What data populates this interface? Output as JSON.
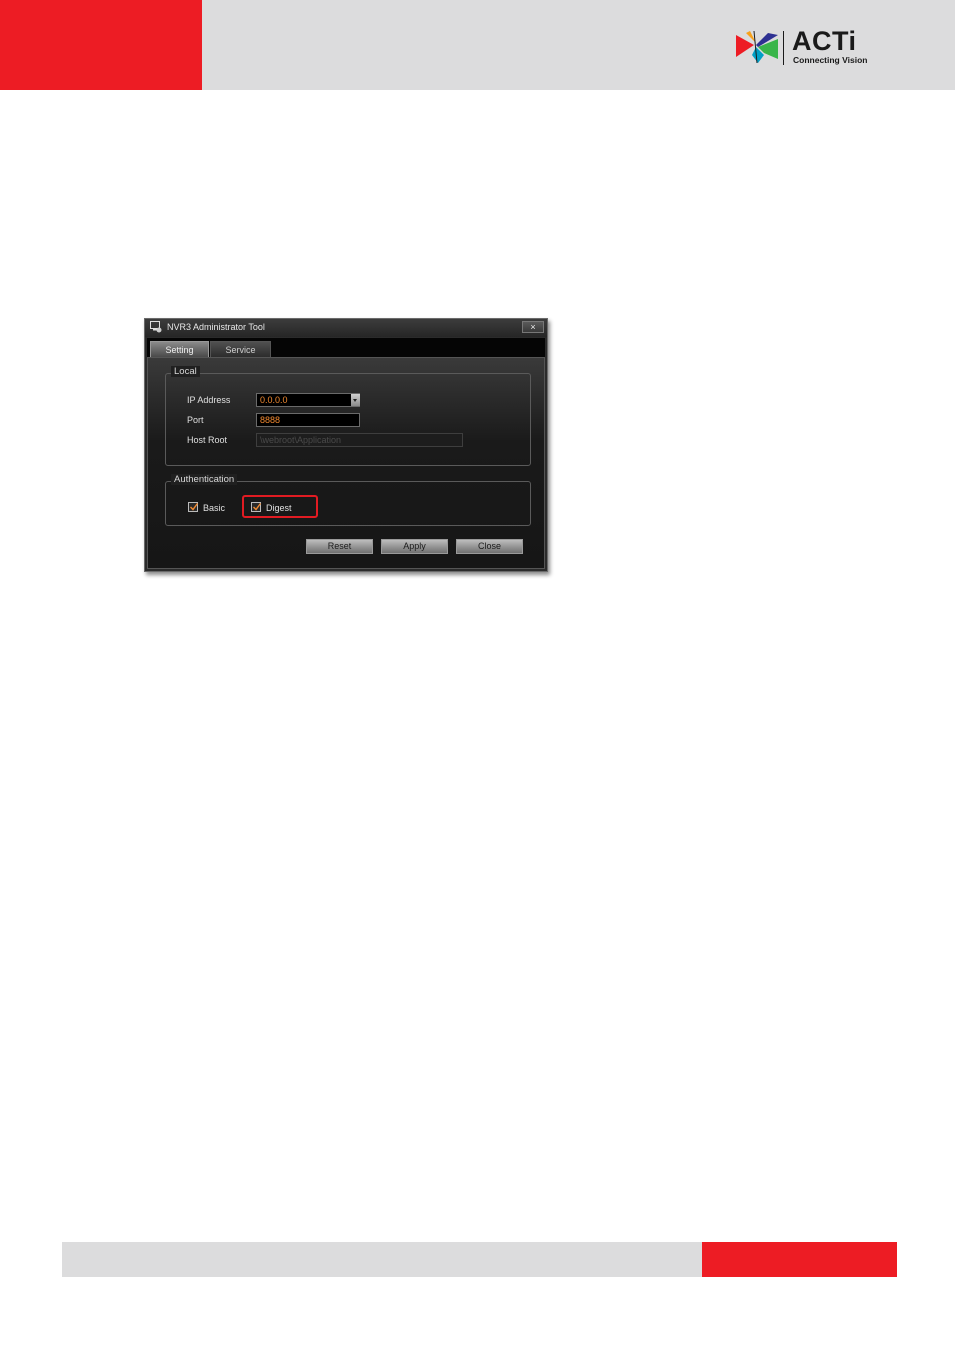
{
  "header": {
    "logo_text": "ACTi",
    "logo_tagline": "Connecting Vision",
    "colors": {
      "red": "#ed1c24",
      "gray": "#dcdcdd"
    }
  },
  "dialog": {
    "title": "NVR3 Administrator Tool",
    "close_label": "×",
    "tabs": [
      {
        "label": "Setting",
        "active": true
      },
      {
        "label": "Service",
        "active": false
      }
    ],
    "local": {
      "legend": "Local",
      "ip_label": "IP Address",
      "ip_value": "0.0.0.0",
      "port_label": "Port",
      "port_value": "8888",
      "host_root_label": "Host Root",
      "host_root_value": "\\webroot\\Application"
    },
    "authentication": {
      "legend": "Authentication",
      "basic_label": "Basic",
      "basic_checked": true,
      "digest_label": "Digest",
      "digest_checked": true
    },
    "buttons": {
      "reset": "Reset",
      "apply": "Apply",
      "close": "Close"
    }
  }
}
